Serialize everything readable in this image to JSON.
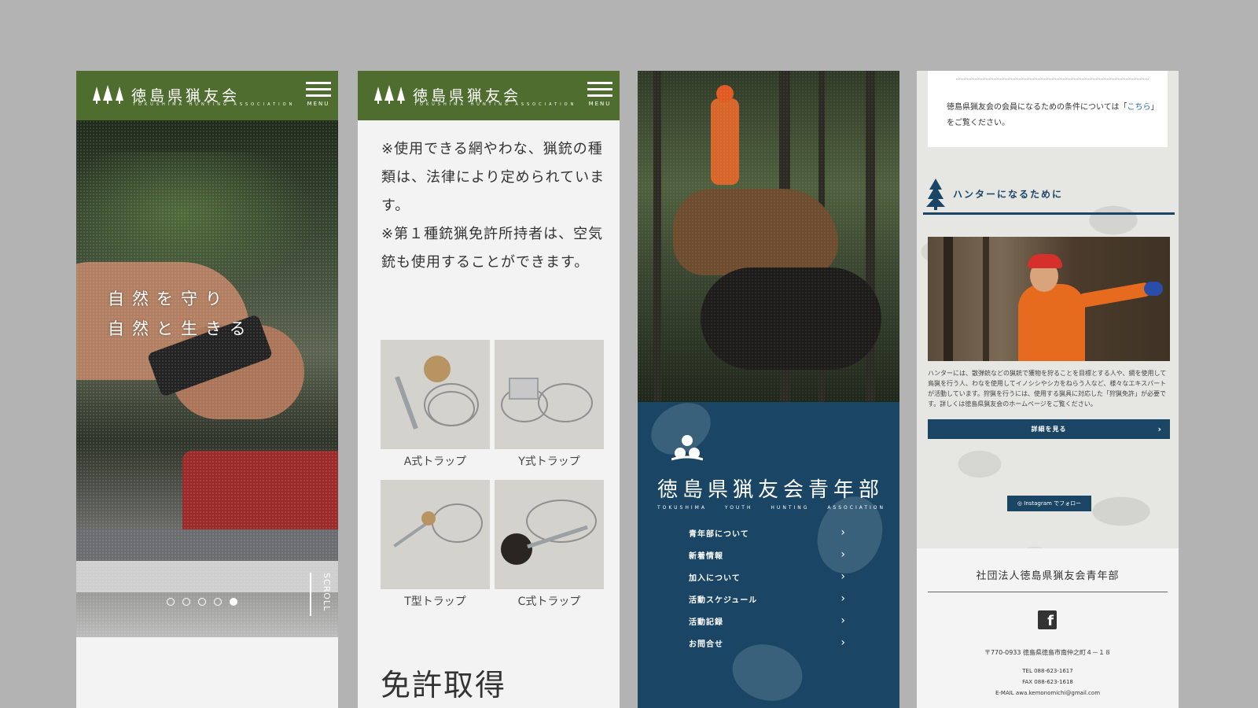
{
  "header": {
    "logo_text": "徳島県猟友会",
    "logo_sub": "TOKUSHIMA HUNTING ASSOCIATION",
    "menu_label": "MENU"
  },
  "hero": {
    "copy_line1": "自然を守り",
    "copy_line2": "自然と生きる",
    "scroll_label": "SCROLL",
    "slides_total": 5,
    "slide_active": 5
  },
  "phone2": {
    "para1": "※使用できる網やわな、猟銃の種類は、法律により定められています。",
    "para2": "※第１種銃猟免許所持者は、空気銃も使用することができます。",
    "traps": [
      {
        "label": "A式トラップ"
      },
      {
        "label": "Y式トラップ"
      },
      {
        "label": "T型トラップ"
      },
      {
        "label": "C式トラップ"
      }
    ],
    "section_title": "免許取得"
  },
  "phone3": {
    "title": "徳島県猟友会青年部",
    "sub": [
      "TOKUSHIMA",
      "YOUTH",
      "HUNTING",
      "ASSOCIATION"
    ],
    "nav": [
      {
        "label": "青年部について"
      },
      {
        "label": "新着情報"
      },
      {
        "label": "加入について"
      },
      {
        "label": "活動スケジュール"
      },
      {
        "label": "活動記録"
      },
      {
        "label": "お問合せ"
      }
    ],
    "accent": "#1a4564"
  },
  "phone4": {
    "top_text_pre": "徳島県猟友会の会員になるための条件については「",
    "top_text_link": "こちら",
    "top_text_post": "」をご覧ください。",
    "section_title": "ハンターになるために",
    "body": "ハンターには、散弾銃などの猟銃で獲物を狩ることを目標とする人や、網を使用して鳥猟を行う人、わなを使用してイノシシやシカをねらう人など、様々なエキスパートが活動しています。狩猟を行うには、使用する猟具に対応した「狩猟免許」が必要です。詳しくは徳島県猟友会のホームページをご覧ください。",
    "detail_button": "詳細を見る",
    "instagram_button": "Instagram でフォロー",
    "footer_name": "社団法人徳島県猟友会青年部",
    "address": "〒770-0933 徳島県徳島市南仲之町４－１８",
    "tel": "TEL 088-623-1617",
    "fax": "FAX 088-623-1618",
    "email": "E-MAIL awa.kemonomichi@gmail.com"
  },
  "colors": {
    "header_green": "#4e6d2e",
    "navy": "#1a4564",
    "background": "#b3b3b3"
  }
}
